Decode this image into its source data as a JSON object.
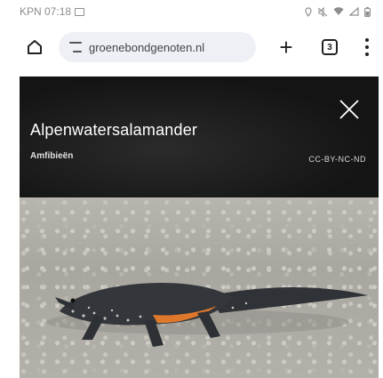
{
  "status_bar": {
    "carrier_time": "KPN 07:18"
  },
  "browser": {
    "url": "groenebondgenoten.nl",
    "tab_count": "3"
  },
  "viewer": {
    "title": "Alpenwatersalamander",
    "category": "Amfibieën",
    "license": "CC-BY-NC-ND"
  },
  "icons": {
    "home": "home-icon",
    "site-settings": "tune-icon",
    "new-tab": "plus-icon",
    "tabs": "tab-switcher-icon",
    "menu": "more-vert-icon",
    "close": "close-icon"
  },
  "colors": {
    "viewer_background": "#1a1a1a",
    "url_bar": "#eef0f5",
    "salamander_belly": "#e0782c"
  }
}
